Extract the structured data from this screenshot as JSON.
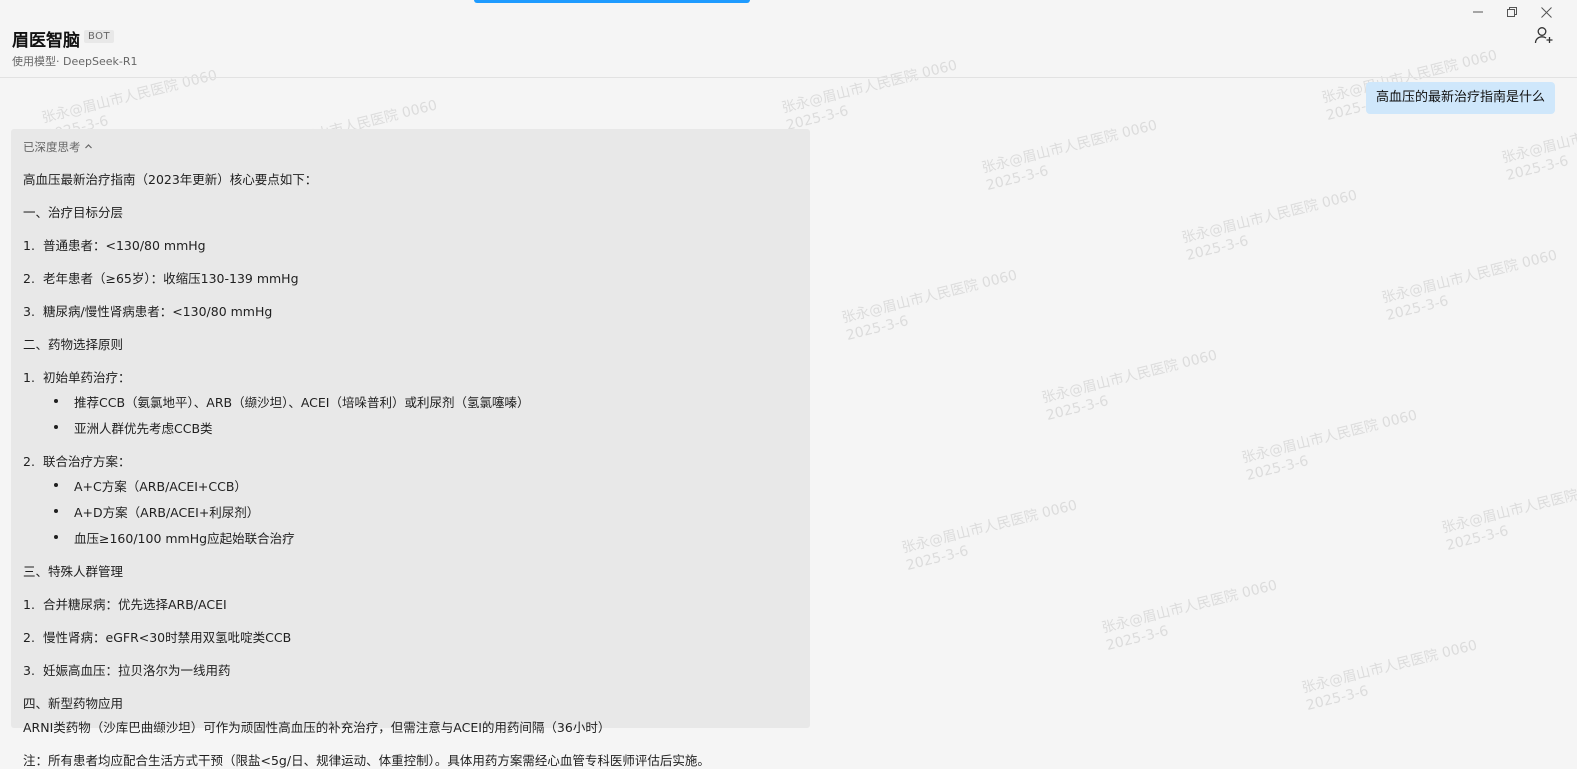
{
  "window": {
    "controls": [
      "minimize-icon",
      "restore-icon",
      "close-icon"
    ]
  },
  "header": {
    "title": "眉医智脑",
    "badge": "BOT",
    "model": "使用模型· DeepSeek-R1",
    "add_icon": "add-user-icon"
  },
  "conversation": {
    "user_message": "高血压的最新治疗指南是什么",
    "reply": {
      "think_label": "已深度思考",
      "intro": "高血压最新治疗指南（2023年更新）核心要点如下：",
      "s1_title": "一、治疗目标分层",
      "s1_items": [
        "普通患者：<130/80 mmHg",
        "老年患者（≥65岁）：收缩压130-139 mmHg",
        "糖尿病/慢性肾病患者：<130/80 mmHg"
      ],
      "s2_title": "二、药物选择原则",
      "s2_item1": "初始单药治疗：",
      "s2_item1_bullets": [
        "推荐CCB（氨氯地平）、ARB（缬沙坦）、ACEI（培哚普利）或利尿剂（氢氯噻嗪）",
        "亚洲人群优先考虑CCB类"
      ],
      "s2_item2": "联合治疗方案：",
      "s2_item2_bullets": [
        "A+C方案（ARB/ACEI+CCB）",
        "A+D方案（ARB/ACEI+利尿剂）",
        "血压≥160/100 mmHg应起始联合治疗"
      ],
      "s3_title": "三、特殊人群管理",
      "s3_items": [
        "合并糖尿病：优先选择ARB/ACEI",
        "慢性肾病：eGFR<30时禁用双氢吡啶类CCB",
        "妊娠高血压：拉贝洛尔为一线用药"
      ],
      "s4_title": "四、新型药物应用",
      "s4_text": "ARNI类药物（沙库巴曲缬沙坦）可作为顽固性高血压的补充治疗，但需注意与ACEI的用药间隔（36小时）",
      "note": "注：所有患者均应配合生活方式干预（限盐<5g/日、规律运动、体重控制）。具体用药方案需经心血管专科医师评估后实施。"
    }
  },
  "watermark": {
    "line1": "张永@眉山市人民医院 0060",
    "line2": "2025-3-6"
  }
}
